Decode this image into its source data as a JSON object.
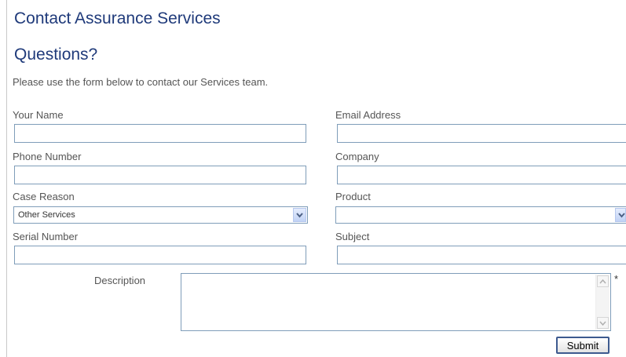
{
  "header": {
    "title": "Contact Assurance Services",
    "subtitle": "Questions?",
    "intro": "Please use the form below to contact our Services team."
  },
  "form": {
    "your_name": {
      "label": "Your Name",
      "value": ""
    },
    "email_address": {
      "label": "Email Address",
      "value": ""
    },
    "phone_number": {
      "label": "Phone Number",
      "value": ""
    },
    "company": {
      "label": "Company",
      "value": ""
    },
    "case_reason": {
      "label": "Case Reason",
      "selected": "Other Services"
    },
    "product": {
      "label": "Product",
      "selected": ""
    },
    "serial_number": {
      "label": "Serial Number",
      "value": ""
    },
    "subject": {
      "label": "Subject",
      "value": ""
    },
    "description": {
      "label": "Description",
      "value": "",
      "required_marker": "*"
    },
    "submit_label": "Submit"
  },
  "colors": {
    "heading": "#1f3a7a",
    "label_text": "#555555",
    "field_border": "#7f9db9",
    "dropdown_button": "#c1d2f5",
    "submit_border": "#3d5a8f"
  },
  "icons": {
    "dropdown": "chevron-down-icon",
    "scroll_up": "chevron-up-icon",
    "scroll_down": "chevron-down-icon"
  }
}
